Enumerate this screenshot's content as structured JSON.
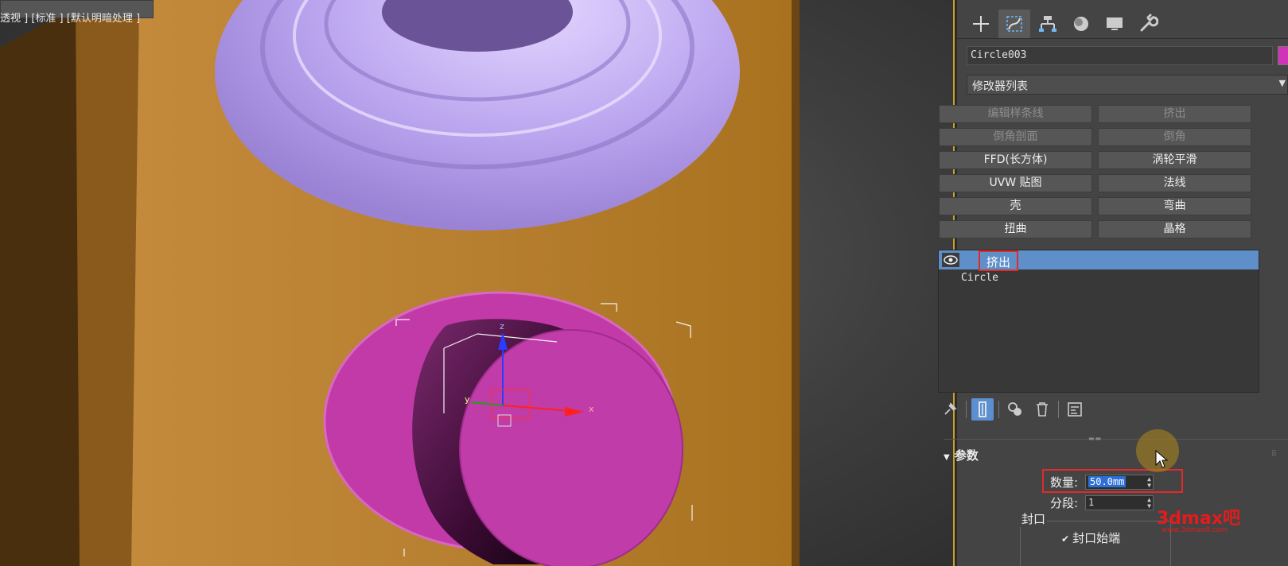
{
  "viewport": {
    "label": "透视 ] [标准 ] [默认明暗处理 ]"
  },
  "panel": {
    "tabs": [
      {
        "icon": "plus-icon",
        "active": false
      },
      {
        "icon": "modify-curve-icon",
        "active": true
      },
      {
        "icon": "hierarchy-icon",
        "active": false
      },
      {
        "icon": "motion-icon",
        "active": false
      },
      {
        "icon": "display-monitor-icon",
        "active": false
      },
      {
        "icon": "wrench-icon",
        "active": false
      }
    ],
    "object_name": "Circle003",
    "object_color": "#d033b8",
    "modifier_list_label": "修改器列表",
    "modifier_buttons": [
      {
        "label": "编辑样条线",
        "enabled": false
      },
      {
        "label": "挤出",
        "enabled": false
      },
      {
        "label": "倒角剖面",
        "enabled": false
      },
      {
        "label": "倒角",
        "enabled": false
      },
      {
        "label": "FFD(长方体)",
        "enabled": true
      },
      {
        "label": "涡轮平滑",
        "enabled": true
      },
      {
        "label": "UVW 贴图",
        "enabled": true
      },
      {
        "label": "法线",
        "enabled": true
      },
      {
        "label": "壳",
        "enabled": true
      },
      {
        "label": "弯曲",
        "enabled": true
      },
      {
        "label": "扭曲",
        "enabled": true
      },
      {
        "label": "晶格",
        "enabled": true
      }
    ],
    "stack": {
      "selected": "挤出",
      "base": "Circle"
    },
    "params": {
      "header": "参数",
      "amount_label": "数量:",
      "amount_value": "50.0mm",
      "segments_label": "分段:",
      "segments_value": "1",
      "cap_group_label": "封口",
      "cap_start_label": "封口始端"
    },
    "watermark": "3dmax吧",
    "watermark_sub": "www.3dmax8.com"
  },
  "colors": {
    "accent_selected": "#5f8fc9",
    "highlight_box": "#e02b2b",
    "wood": "#b07a2c",
    "purple": "#b9a3ee",
    "magenta": "#c23aa8"
  }
}
